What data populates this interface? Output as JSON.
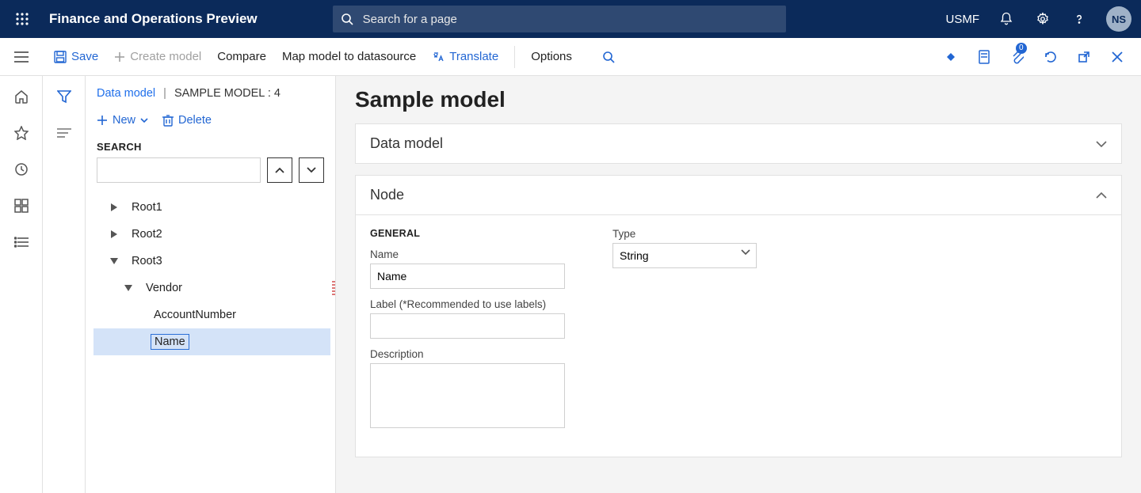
{
  "topbar": {
    "app_title": "Finance and Operations Preview",
    "search_placeholder": "Search for a page",
    "company": "USMF",
    "avatar_initials": "NS"
  },
  "actionbar": {
    "save": "Save",
    "create_model": "Create model",
    "compare": "Compare",
    "map_model": "Map model to datasource",
    "translate": "Translate",
    "options": "Options",
    "attachment_badge": "0"
  },
  "breadcrumb": {
    "link": "Data model",
    "current": "SAMPLE MODEL : 4"
  },
  "toolbar": {
    "new": "New",
    "delete": "Delete"
  },
  "search": {
    "label": "SEARCH",
    "value": ""
  },
  "tree": {
    "items": [
      {
        "label": "Root1",
        "expanded": false,
        "level": 1
      },
      {
        "label": "Root2",
        "expanded": false,
        "level": 1
      },
      {
        "label": "Root3",
        "expanded": true,
        "level": 1
      },
      {
        "label": "Vendor",
        "expanded": true,
        "level": 2
      },
      {
        "label": "AccountNumber",
        "expanded": null,
        "level": 3
      },
      {
        "label": "Name",
        "expanded": null,
        "level": 3,
        "selected": true,
        "boxed": true
      }
    ]
  },
  "page": {
    "title": "Sample model"
  },
  "cards": {
    "data_model": {
      "header": "Data model",
      "collapsed": true
    },
    "node": {
      "header": "Node",
      "collapsed": false
    }
  },
  "node_form": {
    "section": "GENERAL",
    "name_label": "Name",
    "name_value": "Name",
    "label_label": "Label (*Recommended to use labels)",
    "label_value": "",
    "description_label": "Description",
    "description_value": "",
    "type_label": "Type",
    "type_value": "String"
  }
}
